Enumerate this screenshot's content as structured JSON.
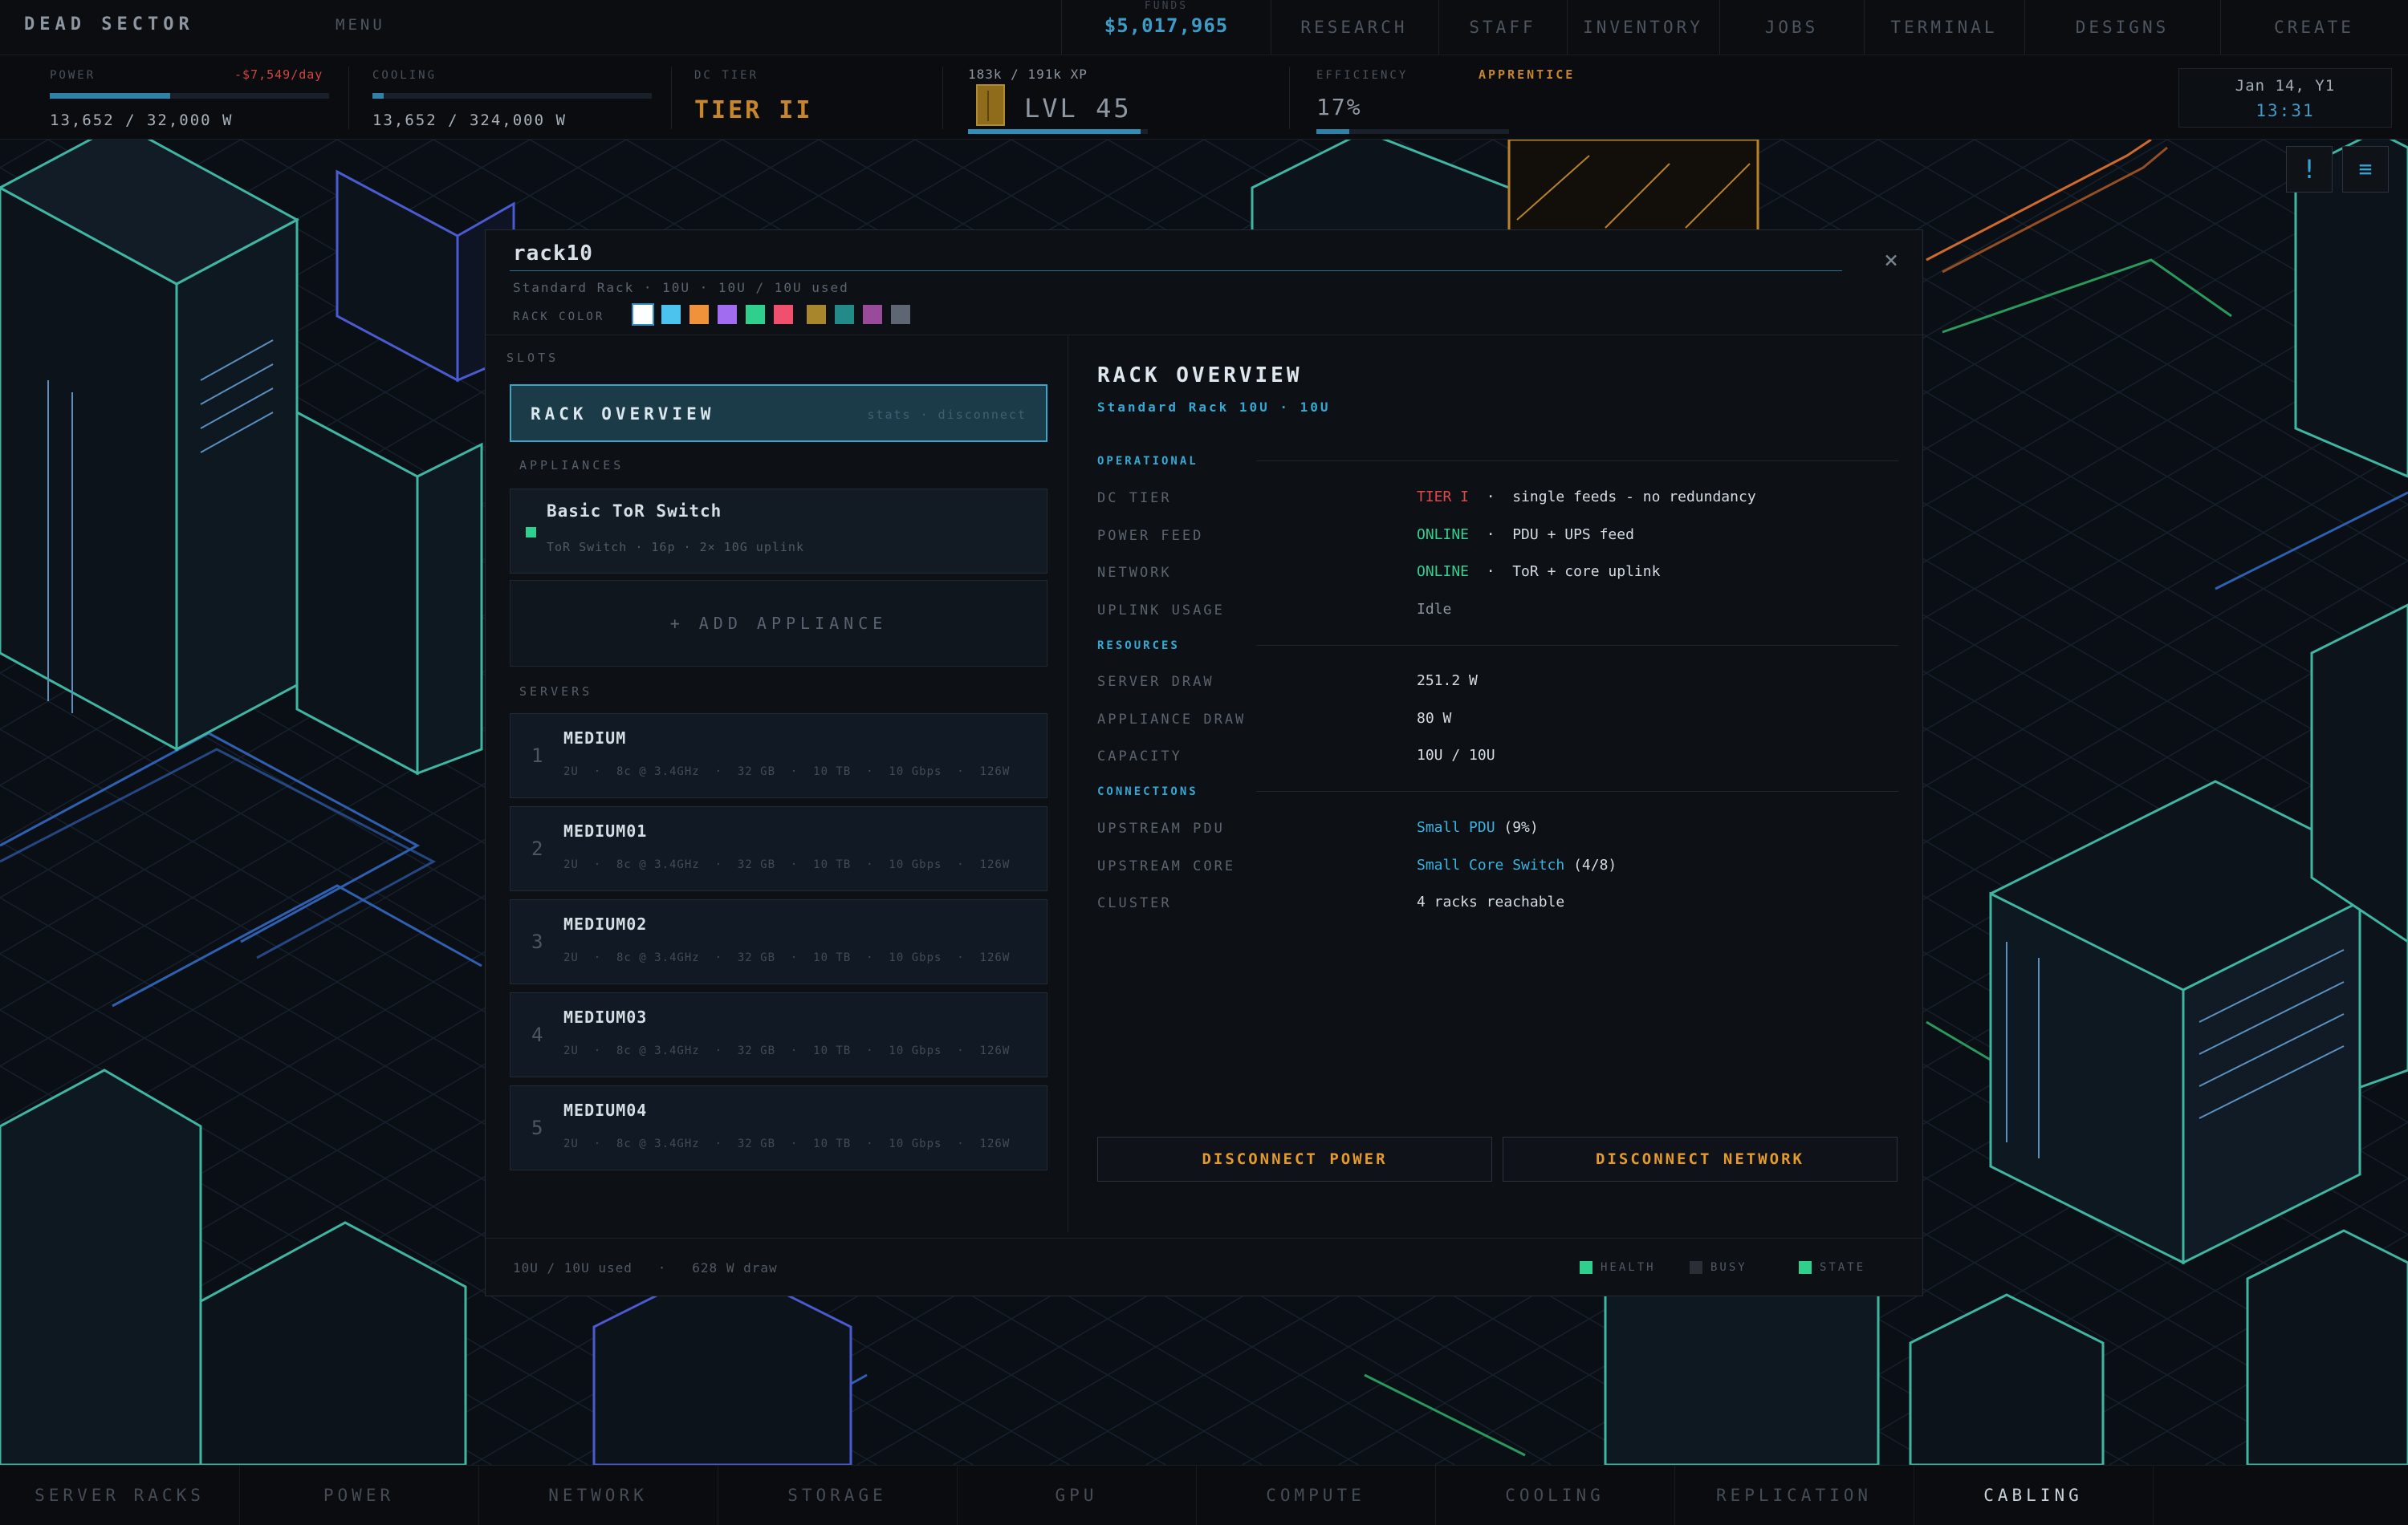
{
  "app": {
    "title": "DEAD SECTOR",
    "menu_label": "MENU"
  },
  "funds": {
    "label": "FUNDS",
    "value": "$5,017,965"
  },
  "nav": [
    "RESEARCH",
    "STAFF",
    "INVENTORY",
    "JOBS",
    "TERMINAL",
    "DESIGNS",
    "CREATE"
  ],
  "stats": {
    "power": {
      "label": "POWER",
      "rate": "-$7,549/day",
      "value": "13,652 / 32,000 W",
      "fill_fraction": 0.43
    },
    "cooling": {
      "label": "COOLING",
      "value": "13,652 / 324,000 W",
      "fill_fraction": 0.04
    },
    "tier": {
      "label": "DC TIER",
      "value": "TIER II"
    },
    "level": {
      "xp": "183k / 191k XP",
      "value": "LVL 45",
      "fill_fraction": 0.96
    },
    "efficiency": {
      "label": "EFFICIENCY",
      "rank": "APPRENTICE",
      "value": "17%",
      "fill_fraction": 0.17
    },
    "datetime": {
      "date": "Jan 14, Y1",
      "time": "13:31"
    }
  },
  "corner_buttons": {
    "alert": "!",
    "list": "≡"
  },
  "modal": {
    "title": "rack10",
    "subtitle": "Standard Rack  ·  10U  ·  10U / 10U used",
    "color_label": "RACK COLOR",
    "colors": [
      "#ffffff",
      "#4cc3ef",
      "#f0923a",
      "#a26cf0",
      "#2fd08d",
      "#f0506e",
      "#a8862c",
      "#238a8a",
      "#9a4a9a",
      "#5e6673"
    ],
    "close_icon": "×",
    "slots_label": "SLOTS",
    "overview_button": {
      "label": "RACK OVERVIEW",
      "hint": "stats · disconnect"
    },
    "appliances_label": "APPLIANCES",
    "appliances": [
      {
        "name": "Basic ToR Switch",
        "meta": "ToR Switch  ·  16p  ·  2× 10G uplink"
      }
    ],
    "add_appliance": "+ ADD APPLIANCE",
    "servers_label": "SERVERS",
    "servers": [
      {
        "num": "1",
        "name": "MEDIUM",
        "meta": "2U  ·  8c @ 3.4GHz  ·  32 GB  ·  10 TB  ·  10 Gbps  ·  126W"
      },
      {
        "num": "2",
        "name": "MEDIUM01",
        "meta": "2U  ·  8c @ 3.4GHz  ·  32 GB  ·  10 TB  ·  10 Gbps  ·  126W"
      },
      {
        "num": "3",
        "name": "MEDIUM02",
        "meta": "2U  ·  8c @ 3.4GHz  ·  32 GB  ·  10 TB  ·  10 Gbps  ·  126W"
      },
      {
        "num": "4",
        "name": "MEDIUM03",
        "meta": "2U  ·  8c @ 3.4GHz  ·  32 GB  ·  10 TB  ·  10 Gbps  ·  126W"
      },
      {
        "num": "5",
        "name": "MEDIUM04",
        "meta": "2U  ·  8c @ 3.4GHz  ·  32 GB  ·  10 TB  ·  10 Gbps  ·  126W"
      }
    ],
    "overview": {
      "title": "RACK OVERVIEW",
      "subtitle": "Standard Rack   10U   ·   10U",
      "operational_label": "OPERATIONAL",
      "dc_tier": {
        "key": "DC TIER",
        "status": "TIER I",
        "detail": "  ·  single feeds - no redundancy"
      },
      "power_feed": {
        "key": "POWER FEED",
        "status": "ONLINE",
        "detail": "  ·  PDU + UPS feed"
      },
      "network": {
        "key": "NETWORK",
        "status": "ONLINE",
        "detail": "  ·  ToR + core uplink"
      },
      "uplink_usage": {
        "key": "UPLINK USAGE",
        "value": "Idle"
      },
      "resources_label": "RESOURCES",
      "server_draw": {
        "key": "SERVER DRAW",
        "value": "251.2 W"
      },
      "appliance_draw": {
        "key": "APPLIANCE DRAW",
        "value": "80 W"
      },
      "capacity": {
        "key": "CAPACITY",
        "value": "10U / 10U"
      },
      "connections_label": "CONNECTIONS",
      "upstream_pdu": {
        "key": "UPSTREAM PDU",
        "link": "Small PDU",
        "detail": " (9%)"
      },
      "upstream_core": {
        "key": "UPSTREAM CORE",
        "link": "Small Core Switch",
        "detail": " (4/8)"
      },
      "cluster": {
        "key": "CLUSTER",
        "value": "4 racks reachable"
      },
      "disconnect_power": "DISCONNECT POWER",
      "disconnect_network": "DISCONNECT NETWORK"
    },
    "footer": {
      "summary": "10U / 10U used   ·   628 W draw",
      "legend": [
        {
          "label": "HEALTH",
          "color": "#2fd08d"
        },
        {
          "label": "BUSY",
          "color": "#2a2f37"
        },
        {
          "label": "STATE",
          "color": "#2fd08d"
        }
      ]
    }
  },
  "bottom_tabs": [
    "SERVER RACKS",
    "POWER",
    "NETWORK",
    "STORAGE",
    "GPU",
    "COMPUTE",
    "COOLING",
    "REPLICATION",
    "CABLING"
  ],
  "active_tab": "CABLING"
}
